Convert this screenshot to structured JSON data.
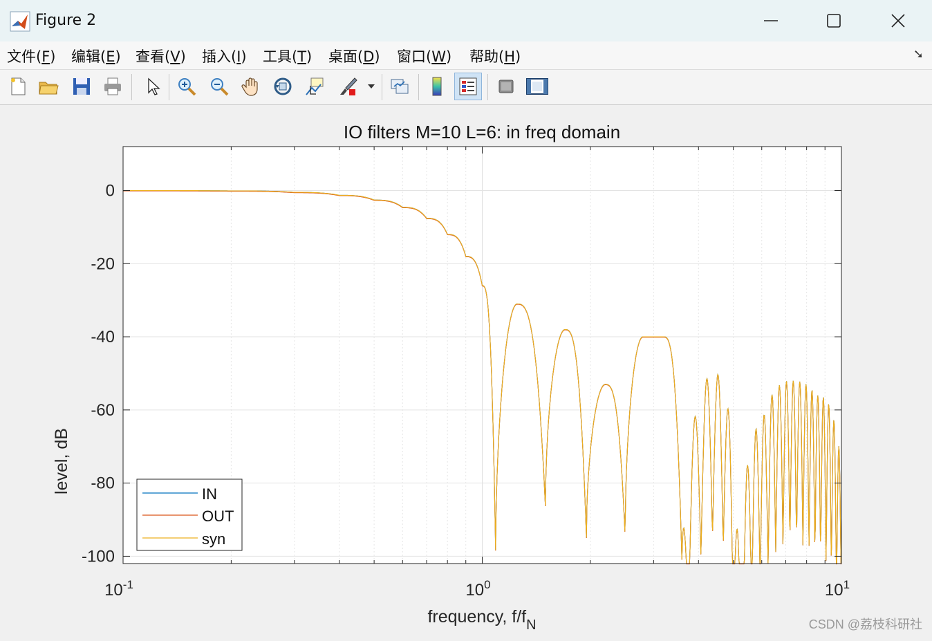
{
  "window": {
    "title": "Figure 2",
    "controls": {
      "minimize": "minimize",
      "maximize": "maximize",
      "close": "close"
    }
  },
  "menu": {
    "items": [
      "文件(F)",
      "编辑(E)",
      "查看(V)",
      "插入(I)",
      "工具(T)",
      "桌面(D)",
      "窗口(W)",
      "帮助(H)"
    ],
    "mnemonics": [
      "F",
      "E",
      "V",
      "I",
      "T",
      "D",
      "W",
      "H"
    ]
  },
  "toolbar": {
    "buttons": [
      {
        "icon": "new-figure-icon"
      },
      {
        "icon": "open-folder-icon"
      },
      {
        "icon": "save-icon"
      },
      {
        "icon": "print-icon"
      },
      {
        "icon": "pointer-icon"
      },
      {
        "icon": "zoom-in-icon"
      },
      {
        "icon": "zoom-out-icon"
      },
      {
        "icon": "pan-hand-icon"
      },
      {
        "icon": "rotate-3d-icon"
      },
      {
        "icon": "data-cursor-icon"
      },
      {
        "icon": "brush-icon"
      },
      {
        "icon": "link-plot-icon"
      },
      {
        "icon": "colorbar-icon"
      },
      {
        "icon": "legend-icon",
        "active": true
      },
      {
        "icon": "hide-plot-tools-icon"
      },
      {
        "icon": "show-plot-tools-icon"
      }
    ]
  },
  "chart_data": {
    "type": "line",
    "title": "IO filters M=10 L=6: in freq domain",
    "xlabel": "frequency, f/f",
    "xlabel_subscript": "N",
    "ylabel": "level, dB",
    "xscale": "log",
    "xlim": [
      0.1,
      10
    ],
    "ylim": [
      -102,
      12
    ],
    "yticks": [
      0,
      -20,
      -40,
      -60,
      -80,
      -100
    ],
    "ytick_labels": [
      "0",
      "-20",
      "-40",
      "-60",
      "-80",
      "-100"
    ],
    "xtick_base": "10",
    "xtick_exponents": [
      "-1",
      "0",
      "1"
    ],
    "grid": true,
    "legend_position": "bottom-left",
    "series": [
      {
        "name": "IN",
        "color": "#0072bd"
      },
      {
        "name": "OUT",
        "color": "#d95319"
      },
      {
        "name": "syn",
        "color": "#edb120"
      }
    ],
    "approx_response": {
      "x": [
        0.1,
        0.2,
        0.3,
        0.4,
        0.5,
        0.6,
        0.7,
        0.8,
        0.9,
        1.0,
        1.09,
        1.25,
        1.5,
        1.7,
        1.95,
        2.2,
        2.5,
        2.8,
        3.2,
        3.6,
        4.4,
        5.2,
        6.2,
        7.2,
        8.5,
        10
      ],
      "y": [
        0,
        -0.1,
        -0.5,
        -1.3,
        -2.6,
        -4.6,
        -7.6,
        -12,
        -18,
        -26,
        -100,
        -31,
        -87,
        -38,
        -95,
        -53,
        -95,
        -40,
        -40,
        -103,
        -50,
        -103,
        -61,
        -52,
        -56,
        -75
      ]
    }
  },
  "watermark": "CSDN @荔枝科研社"
}
